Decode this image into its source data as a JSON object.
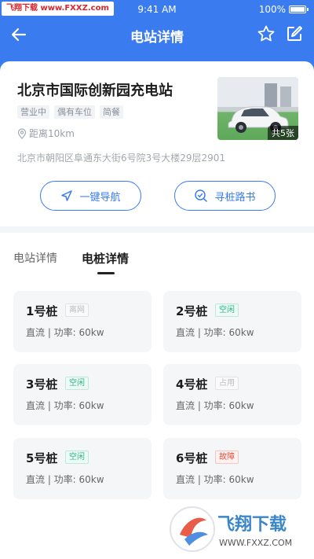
{
  "status_bar": {
    "watermark": "飞翔下载 www.FXXZ.com",
    "time": "9:41 AM",
    "battery": "100%"
  },
  "header": {
    "title": "电站详情",
    "back_icon": "back-arrow-icon",
    "star_icon": "star-icon",
    "edit_icon": "edit-icon",
    "bg_color": "#3a7bf0"
  },
  "station": {
    "name": "北京市国际创新园充电站",
    "tags": [
      "营业中",
      "偶有车位",
      "简餐"
    ],
    "distance": "距离10km",
    "address": "北京市朝阳区阜通东大街6号院3号大楼29层2901",
    "photo_count": "共5张"
  },
  "actions": {
    "navigate": "一键导航",
    "guide": "寻桩路书"
  },
  "tabs": {
    "station_detail": "电站详情",
    "pile_detail": "电桩详情"
  },
  "piles": [
    {
      "name": "1号桩",
      "status": "离网",
      "desc": "直流 | 功率: 60kw"
    },
    {
      "name": "2号桩",
      "status": "空闲",
      "desc": "直流 | 功率: 60kw"
    },
    {
      "name": "3号桩",
      "status": "空闲",
      "desc": "直流 | 功率: 60kw"
    },
    {
      "name": "4号桩",
      "status": "占用",
      "desc": "直流 | 功率: 60kw"
    },
    {
      "name": "5号桩",
      "status": "空闲",
      "desc": "直流 | 功率: 60kw"
    },
    {
      "name": "6号桩",
      "status": "故障",
      "desc": "直流 | 功率: 60kw"
    }
  ],
  "bottom_watermark": {
    "brand": "飞翔下载",
    "url": "WWW.FXXZ.COM"
  }
}
